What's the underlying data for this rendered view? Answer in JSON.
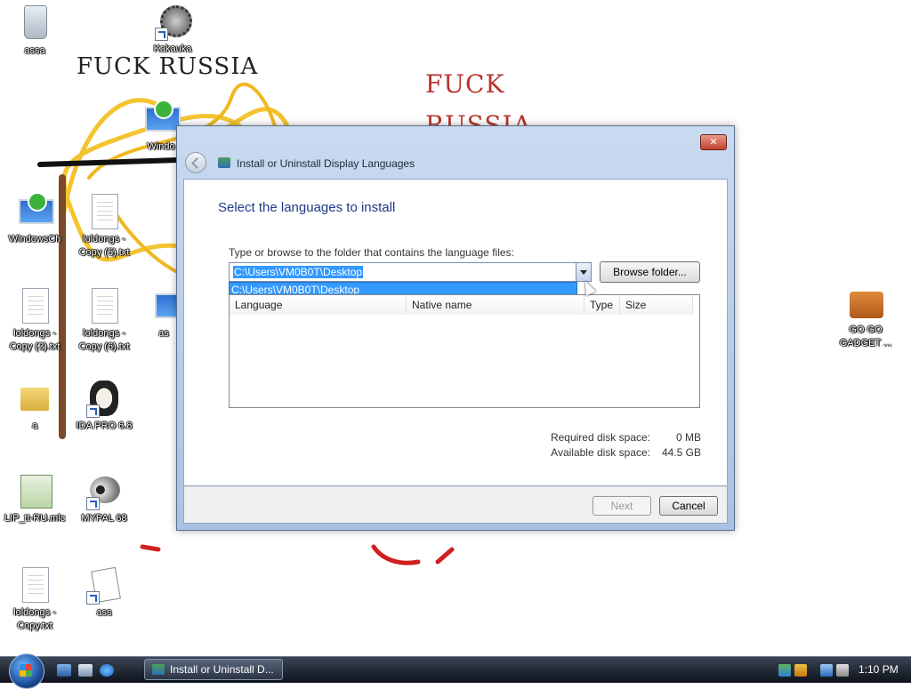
{
  "wallpaper": {
    "text_black": "FUCK RUSSIA",
    "text_red_1": "FUCK",
    "text_red_2": "RUSSIA"
  },
  "desktop_icons": [
    {
      "label": "assa",
      "icon": "recycle-bin-icon"
    },
    {
      "label": "Kakauka",
      "icon": "spiked-ball-icon"
    },
    {
      "label": "Windo",
      "icon": "windows-update-icon"
    },
    {
      "label": "WindowsCh",
      "icon": "windows-update-icon"
    },
    {
      "label": "loldongs -\nCopy (5).txt",
      "icon": "text-file-icon"
    },
    {
      "label": "loldongs -\nCopy (2).txt",
      "icon": "text-file-icon"
    },
    {
      "label": "loldongs -\nCopy (6).txt",
      "icon": "text-file-icon"
    },
    {
      "label": "as",
      "icon": "network-icon"
    },
    {
      "label": "a",
      "icon": "folder-icon"
    },
    {
      "label": "IDA PRO 6.8",
      "icon": "ida-pro-icon"
    },
    {
      "label": "LIP_tt-RU.mlc",
      "icon": "language-pack-icon"
    },
    {
      "label": "MYPAL 68",
      "icon": "raccoon-icon"
    },
    {
      "label": "loldongs -\nCopy.txt",
      "icon": "text-file-icon"
    },
    {
      "label": "ass",
      "icon": "solitaire-icon"
    },
    {
      "label": "GO GO\nGADGET ...",
      "icon": "briefcase-icon"
    }
  ],
  "dialog": {
    "title": "Install or Uninstall Display Languages",
    "close_label": "✕",
    "heading": "Select the languages to install",
    "prompt": "Type or browse to the folder that contains the language files:",
    "path_value": "C:\\Users\\VM0B0T\\Desktop",
    "suggestion": "C:\\Users\\VM0B0T\\Desktop",
    "browse_label": "Browse folder...",
    "columns": [
      "Language",
      "Native name",
      "Type",
      "Size"
    ],
    "required_label": "Required disk space:",
    "required_value": "0 MB",
    "available_label": "Available disk space:",
    "available_value": "44.5 GB",
    "next_label": "Next",
    "cancel_label": "Cancel"
  },
  "taskbar": {
    "task_label": "Install or Uninstall D...",
    "clock": "1:10 PM"
  }
}
